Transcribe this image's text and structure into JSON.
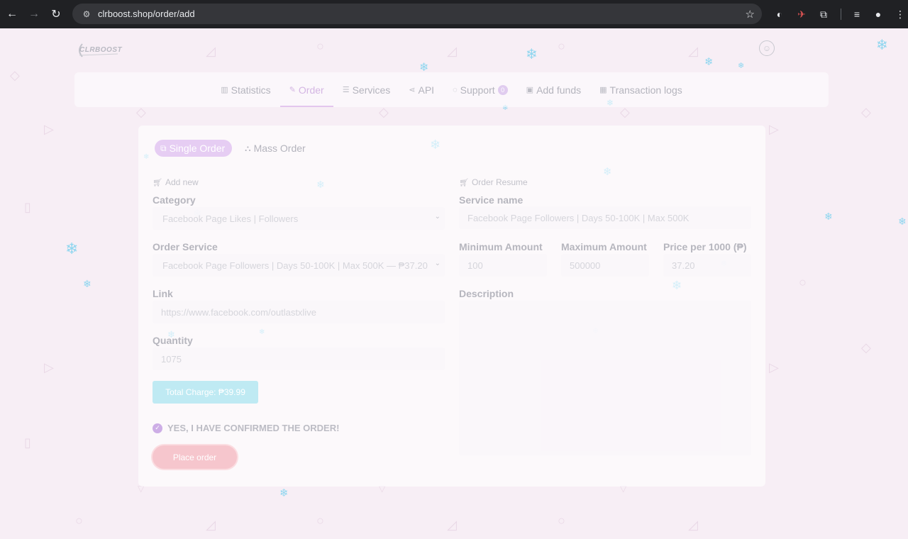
{
  "browser": {
    "url": "clrboost.shop/order/add"
  },
  "brand": {
    "logo_text": "CLRBOOST"
  },
  "nav": {
    "items": [
      {
        "label": "Statistics",
        "icon": "bar-chart-icon"
      },
      {
        "label": "Order",
        "icon": "edit-icon",
        "active": true
      },
      {
        "label": "Services",
        "icon": "list-icon"
      },
      {
        "label": "API",
        "icon": "share-icon"
      },
      {
        "label": "Support",
        "icon": "chat-icon",
        "badge": "0"
      },
      {
        "label": "Add funds",
        "icon": "wallet-icon"
      },
      {
        "label": "Transaction logs",
        "icon": "calendar-icon"
      }
    ]
  },
  "tabs": {
    "single": "Single Order",
    "mass": "Mass Order"
  },
  "form": {
    "add_new": "Add new",
    "category_label": "Category",
    "category_value": "Facebook Page Likes | Followers",
    "service_label": "Order Service",
    "service_value": "Facebook Page Followers | Days 50-100K | Max 500K — ₱37.20",
    "link_label": "Link",
    "link_value": "https://www.facebook.com/outlastxlive",
    "quantity_label": "Quantity",
    "quantity_value": "1075",
    "total_charge": "Total Charge: ₱39.99",
    "confirm_text": "YES, I HAVE CONFIRMED THE ORDER!",
    "place_order": "Place order"
  },
  "resume": {
    "heading": "Order Resume",
    "service_name_label": "Service name",
    "service_name_value": "Facebook Page Followers | Days 50-100K | Max 500K",
    "min_label": "Minimum Amount",
    "min_value": "100",
    "max_label": "Maximum Amount",
    "max_value": "500000",
    "price_label": "Price per 1000 (₱)",
    "price_value": "37.20",
    "description_label": "Description"
  },
  "colors": {
    "accent": "#e6cdf3",
    "charge": "#bfeaf3",
    "place_order": "#f6c6cd",
    "page_bg": "#f7eef5"
  }
}
